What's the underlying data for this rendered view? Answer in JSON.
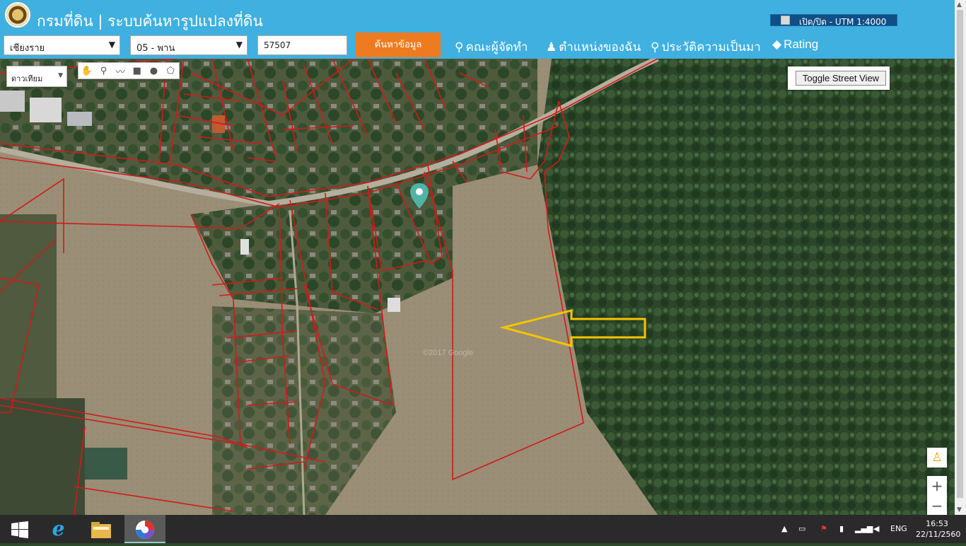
{
  "header": {
    "title": "กรมที่ดิน | ระบบค้นหารูปแปลงที่ดิน",
    "utm_toggle": "เปิด/ปิด - UTM 1:4000"
  },
  "search": {
    "province": "เชียงราย",
    "district": "05 - พาน",
    "parcel_number": "57507",
    "search_label": "ค้นหาข้อมูล"
  },
  "nav": {
    "team": "คณะผู้จัดทำ",
    "location": "ตำแหน่งของฉัน",
    "history": "ประวัติความเป็นมา",
    "rating": "Rating"
  },
  "map": {
    "map_type": "ดาวเทียม",
    "street_view": "Toggle Street View",
    "zoom_in": "+",
    "zoom_out": "−",
    "watermark": "©2017 Google"
  },
  "taskbar": {
    "language": "ENG",
    "time": "16:53",
    "date": "22/11/2560"
  },
  "colors": {
    "header_bg": "#3fb0e0",
    "search_button": "#ee7b1f",
    "parcel_lines": "#d21a1a",
    "highlight_arrow": "#f5c400",
    "marker": "#4fb3a5"
  },
  "icons": [
    "logo-seal",
    "team-icon",
    "person-icon",
    "history-icon",
    "tag-icon",
    "hand-icon",
    "marker-icon",
    "polyline-icon",
    "rectangle-icon",
    "circle-icon",
    "polygon-icon",
    "pegman-icon",
    "windows-icon",
    "ie-icon",
    "folder-icon",
    "browser-icon"
  ]
}
